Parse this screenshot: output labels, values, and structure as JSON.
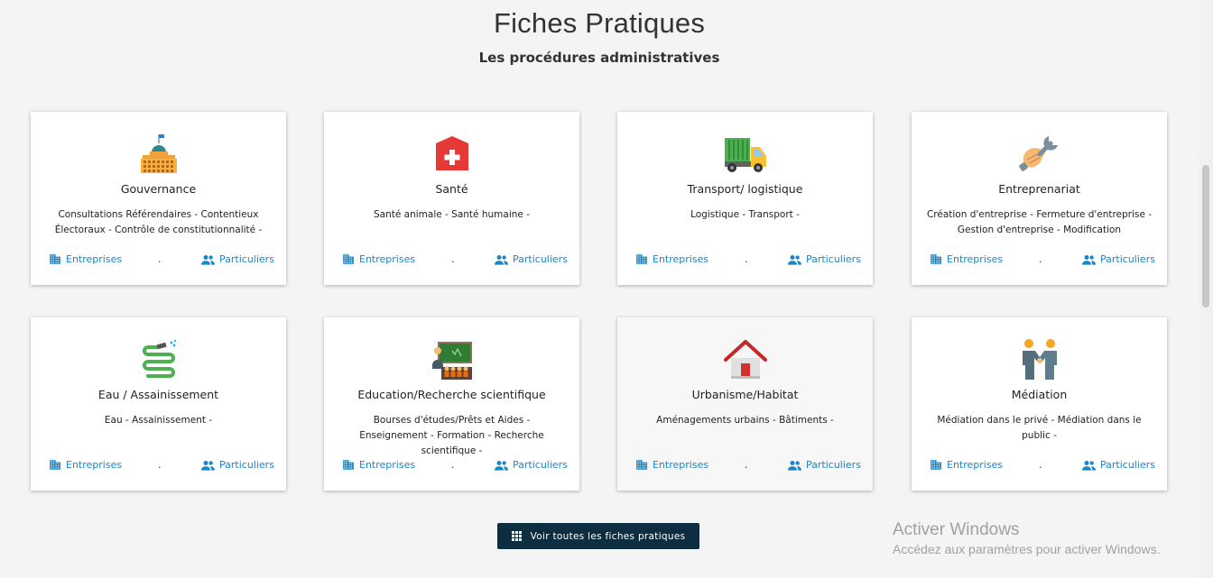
{
  "header": {
    "title": "Fiches Pratiques",
    "subtitle": "Les procédures administratives"
  },
  "cards": [
    {
      "title": "Gouvernance",
      "desc": "Consultations Référendaires - Contentieux Électoraux - Contrôle de constitutionnalité -",
      "icon": "capitol-building-icon",
      "entreprises": "Entreprises",
      "separator": ".",
      "particuliers": "Particuliers"
    },
    {
      "title": "Santé",
      "desc": "Santé animale - Santé humaine -",
      "icon": "medical-cross-icon",
      "entreprises": "Entreprises",
      "separator": ".",
      "particuliers": "Particuliers"
    },
    {
      "title": "Transport/ logistique",
      "desc": "Logistique - Transport -",
      "icon": "truck-icon",
      "entreprises": "Entreprises",
      "separator": ".",
      "particuliers": "Particuliers"
    },
    {
      "title": "Entreprenariat",
      "desc": "Création d'entreprise - Fermeture d'entreprise - Gestion d'entreprise - Modification",
      "icon": "wrench-hand-icon",
      "entreprises": "Entreprises",
      "separator": ".",
      "particuliers": "Particuliers"
    },
    {
      "title": "Eau / Assainissement",
      "desc": "Eau - Assainissement -",
      "icon": "water-hose-icon",
      "entreprises": "Entreprises",
      "separator": ".",
      "particuliers": "Particuliers"
    },
    {
      "title": "Education/Recherche scientifique",
      "desc": "Bourses d'études/Prêts et Aides - Enseignement - Formation - Recherche scientifique -",
      "icon": "classroom-icon",
      "entreprises": "Entreprises",
      "separator": ".",
      "particuliers": "Particuliers"
    },
    {
      "title": "Urbanisme/Habitat",
      "desc": "Aménagements urbains - Bâtiments -",
      "icon": "house-icon",
      "entreprises": "Entreprises",
      "separator": ".",
      "particuliers": "Particuliers"
    },
    {
      "title": "Médiation",
      "desc": "Médiation dans le privé - Médiation dans le public -",
      "icon": "handshake-people-icon",
      "entreprises": "Entreprises",
      "separator": ".",
      "particuliers": "Particuliers"
    }
  ],
  "actions": {
    "see_all": "Voir toutes les fiches pratiques"
  },
  "watermark": {
    "title": "Activer Windows",
    "subtitle": "Accédez aux paramètres pour activer Windows."
  },
  "colors": {
    "link": "#1a86c8",
    "button_bg": "#0d2d40",
    "background": "#f4f4f4"
  }
}
